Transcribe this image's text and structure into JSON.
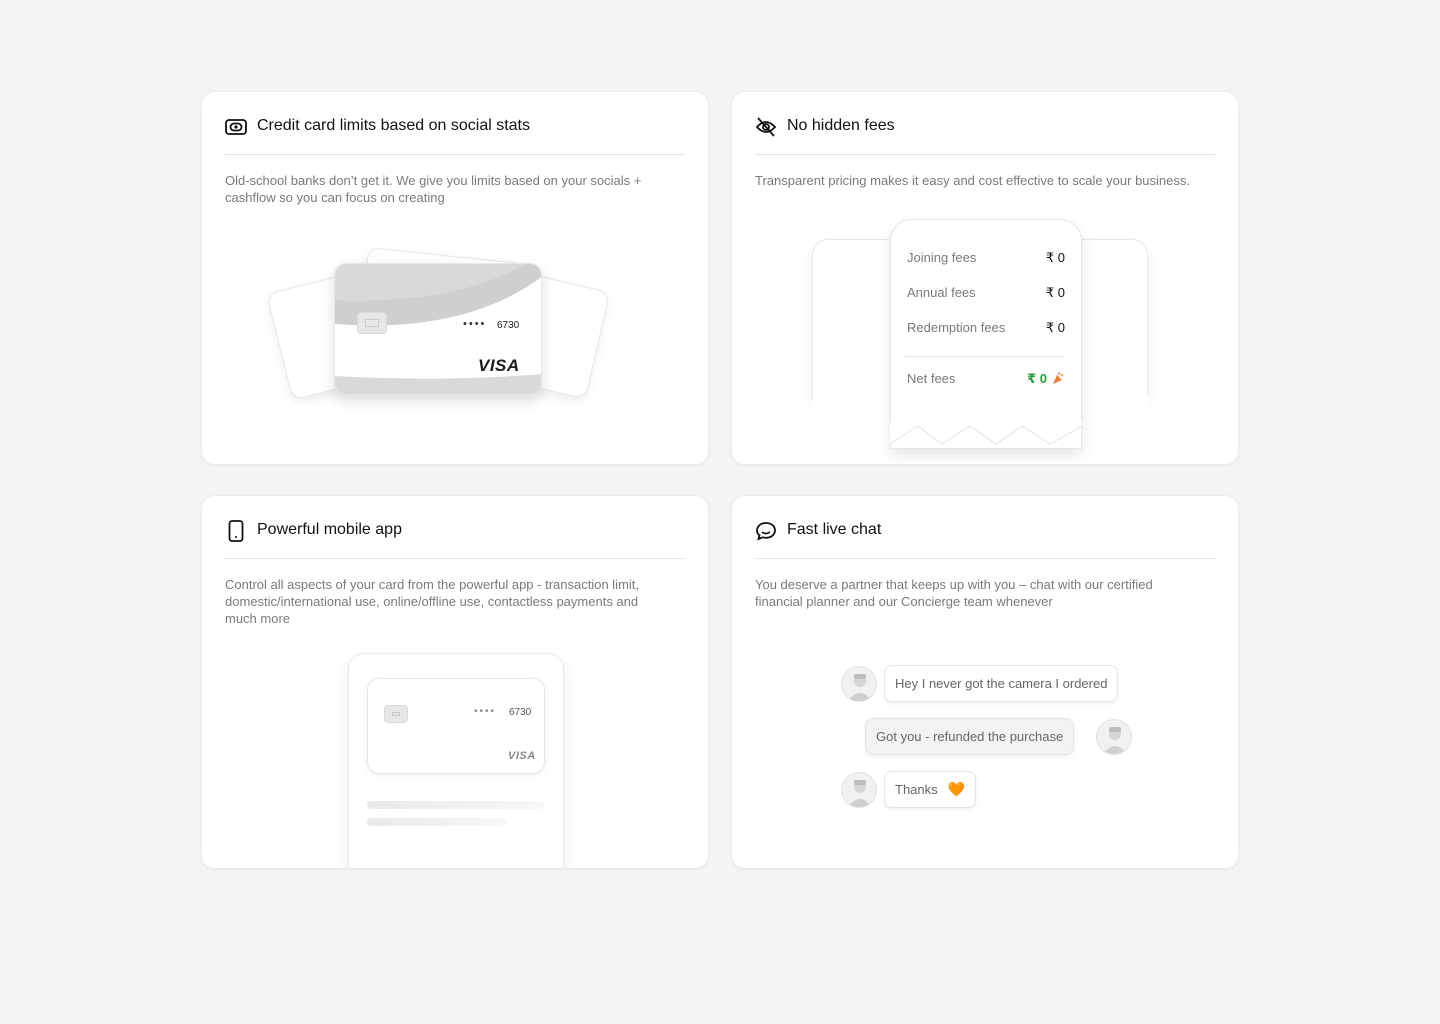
{
  "panels": {
    "credit": {
      "title": "Credit card limits based on social stats",
      "description": "Old-school banks don’t get it. We give you limits based on your socials + cashflow so you can focus on creating",
      "icon": "cash-icon",
      "card": {
        "dots": "••••",
        "number": "6730",
        "brand": "VISA"
      }
    },
    "fees": {
      "title": "No hidden fees",
      "description": "Transparent pricing makes it easy and cost effective to scale your business.",
      "icon": "eye-off-icon",
      "rows": [
        {
          "label": "Joining fees",
          "value": "₹ 0"
        },
        {
          "label": "Annual fees",
          "value": "₹ 0"
        },
        {
          "label": "Redemption fees",
          "value": "₹ 0"
        }
      ],
      "net": {
        "label": "Net fees",
        "value": "₹ 0"
      }
    },
    "mobile": {
      "title": "Powerful mobile app",
      "description": "Control all aspects of your card from the powerful app - transaction limit, domestic/international use, online/offline use, contactless payments and much more",
      "icon": "smartphone-icon",
      "card": {
        "dots": "••••",
        "number": "6730",
        "brand": "VISA"
      }
    },
    "chat": {
      "title": "Fast live chat",
      "description": "You deserve a partner that keeps up with you – chat with our certified financial planner and our Concierge team whenever",
      "icon": "chat-bubble-icon",
      "messages": [
        {
          "text": "Hey I never got the camera I ordered"
        },
        {
          "text": "Got you - refunded the purchase"
        },
        {
          "text": "Thanks",
          "emoji": "🧡"
        }
      ]
    }
  },
  "colors": {
    "accent_green": "#21a038",
    "heart_orange": "#ee7d3b",
    "page_bg": "#f4f4f4"
  }
}
